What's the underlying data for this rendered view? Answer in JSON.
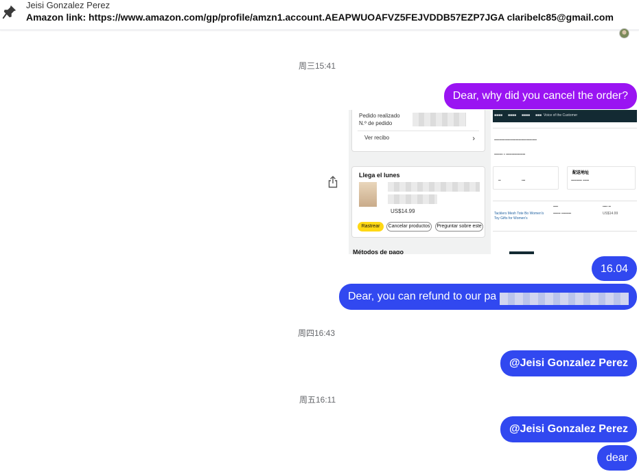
{
  "pinned": {
    "sender": "Jeisi Gonzalez Perez",
    "text": "Amazon link: https://www.amazon.com/gp/profile/amzn1.account.AEAPWUOAFVZ5FEJVDDB57EZP7JGA claribelc85@gmail.com",
    "icon": "pin-icon"
  },
  "timestamps": {
    "wed": "周三15:41",
    "thu": "周四16:43",
    "fri": "周五16:11"
  },
  "messages": {
    "m1": "Dear, why did you cancel the order?",
    "m2": "16.04",
    "m3": "Dear, you can refund to our pa",
    "m4": "@Jeisi Gonzalez Perez",
    "m5": "@Jeisi Gonzalez Perez",
    "m6": "dear"
  },
  "colors": {
    "bubble_purple": "#9a14f2",
    "bubble_blue": "#3148f0"
  },
  "attachment": {
    "left": {
      "order_placed": "Pedido realizado",
      "order_number": "N.º de pedido",
      "view_receipt": "Ver recibo",
      "arrives": "Llega el lunes",
      "price": "US$14.99",
      "track": "Rastrear",
      "cancel": "Cancelar productos",
      "ask": "Preguntar sobre este",
      "payment": "Métodos de pago"
    },
    "right": {
      "nav_voice": "Voice of the Customer",
      "shipping_address": "配送地址",
      "item_line1": "Tacklers Mesh Tote Bo Women's",
      "item_line2": "Toy Gifts for Women's",
      "price": "US$14.99"
    }
  }
}
